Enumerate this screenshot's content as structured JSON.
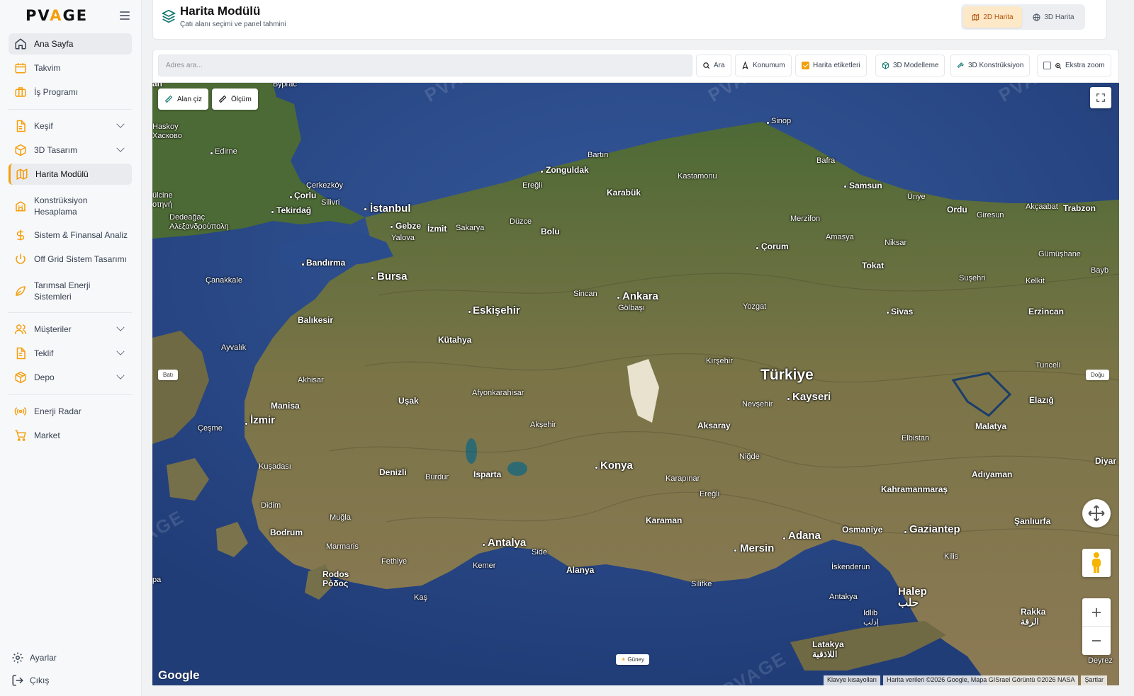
{
  "brand": {
    "logo_pre": "PV",
    "logo_mid": "A",
    "logo_post": "GE"
  },
  "sidebar": {
    "items": [
      {
        "label": "Ana Sayfa",
        "icon": "home-icon"
      },
      {
        "label": "Takvim",
        "icon": "calendar-icon"
      },
      {
        "label": "İş Programı",
        "icon": "briefcase-icon"
      },
      {
        "label": "Keşif",
        "icon": "file-icon"
      },
      {
        "label": "3D Tasarım",
        "icon": "cube-icon"
      },
      {
        "label": "Harita Modülü",
        "icon": "map-icon"
      },
      {
        "label": "Konstrüksiyon Hesaplama",
        "icon": "building-icon"
      },
      {
        "label": "Sistem & Finansal Analiz",
        "icon": "dollar-icon"
      },
      {
        "label": "Off Grid Sistem Tasarımı",
        "icon": "power-icon"
      },
      {
        "label": "Tarımsal Enerji Sistemleri",
        "icon": "leaf-icon"
      },
      {
        "label": "Müşteriler",
        "icon": "users-icon"
      },
      {
        "label": "Teklif",
        "icon": "document-icon"
      },
      {
        "label": "Depo",
        "icon": "package-icon"
      },
      {
        "label": "Enerji Radar",
        "icon": "radar-icon"
      },
      {
        "label": "Market",
        "icon": "cart-icon"
      }
    ],
    "footer": [
      {
        "label": "Ayarlar",
        "icon": "gear-icon"
      },
      {
        "label": "Çıkış",
        "icon": "logout-icon"
      }
    ]
  },
  "header": {
    "title": "Harita Modülü",
    "subtitle": "Çatı alanı seçimi ve panel tahmini",
    "view_2d": "2D Harita",
    "view_3d": "3D Harita",
    "active_view": "2D Harita"
  },
  "toolbar": {
    "search_placeholder": "Adres ara...",
    "search_button": "Ara",
    "location_button": "Konumum",
    "labels_toggle": "Harita etiketleri",
    "labels_checked": true,
    "modeling_button": "3D Modelleme",
    "construction_button": "3D Konstrüksiyon",
    "extra_zoom": "Ekstra zoom",
    "extra_zoom_checked": false
  },
  "map": {
    "draw_area": "Alan çiz",
    "measure": "Ölçüm",
    "compass": {
      "west": "Batı",
      "east": "Doğu",
      "south": "Güney"
    },
    "watermark": "PVAGE",
    "google": "Google",
    "attribution": {
      "shortcuts": "Klavye kısayolları",
      "data": "Harita verileri ©2026 Google, Mapa GISrael Görüntü ©2026 NASA",
      "terms": "Şartlar"
    },
    "country": "Türkiye",
    "places": [
      {
        "name": "Burgas",
        "text": "Бургас"
      },
      {
        "name": "Haskovo",
        "text": "Haskoy\nХасково"
      },
      {
        "name": "Edirne",
        "text": "Edirne"
      },
      {
        "name": "Çerkezköy",
        "text": "Çerkezköy"
      },
      {
        "name": "Çorlu",
        "text": "Çorlu"
      },
      {
        "name": "Silivri",
        "text": "Silivri"
      },
      {
        "name": "Tekirdağ",
        "text": "Tekirdağ"
      },
      {
        "name": "İstanbul",
        "text": "İstanbul"
      },
      {
        "name": "Gebze",
        "text": "Gebze"
      },
      {
        "name": "İzmit",
        "text": "İzmit"
      },
      {
        "name": "Sakarya",
        "text": "Sakarya"
      },
      {
        "name": "Yalova",
        "text": "Yalova"
      },
      {
        "name": "Dedeağaç",
        "text": "Dedeağaç\nΑλεξανδρούπολη"
      },
      {
        "name": "Komotini",
        "text": "ülcine\nοτηνή"
      },
      {
        "name": "Bartın",
        "text": "Bartın"
      },
      {
        "name": "Zonguldak",
        "text": "Zonguldak"
      },
      {
        "name": "Ereğli",
        "text": "Ereğli"
      },
      {
        "name": "Karabük",
        "text": "Karabük"
      },
      {
        "name": "Kastamonu",
        "text": "Kastamonu"
      },
      {
        "name": "Sinop",
        "text": "Sinop"
      },
      {
        "name": "Bafra",
        "text": "Bafra"
      },
      {
        "name": "Samsun",
        "text": "Samsun"
      },
      {
        "name": "Ünye",
        "text": "Ünye"
      },
      {
        "name": "Ordu",
        "text": "Ordu"
      },
      {
        "name": "Giresun",
        "text": "Giresun"
      },
      {
        "name": "Akçaabat",
        "text": "Akçaabat"
      },
      {
        "name": "Trabzon",
        "text": "Trabzon"
      },
      {
        "name": "Düzce",
        "text": "Düzce"
      },
      {
        "name": "Bolu",
        "text": "Bolu"
      },
      {
        "name": "Merzifon",
        "text": "Merzifon"
      },
      {
        "name": "Amasya",
        "text": "Amasya"
      },
      {
        "name": "Niksar",
        "text": "Niksar"
      },
      {
        "name": "Çorum",
        "text": "Çorum"
      },
      {
        "name": "Tokat",
        "text": "Tokat"
      },
      {
        "name": "Gümüşhane",
        "text": "Gümüşhane"
      },
      {
        "name": "Bayburt",
        "text": "Bayb"
      },
      {
        "name": "Suşehri",
        "text": "Suşehri"
      },
      {
        "name": "Kelkit",
        "text": "Kelkit"
      },
      {
        "name": "Bandırma",
        "text": "Bandırma"
      },
      {
        "name": "Bursa",
        "text": "Bursa"
      },
      {
        "name": "Çanakkale",
        "text": "Çanakkale"
      },
      {
        "name": "Sincan",
        "text": "Sincan"
      },
      {
        "name": "Ankara",
        "text": "Ankara"
      },
      {
        "name": "Gölbaşı",
        "text": "Gölbaşı"
      },
      {
        "name": "Yozgat",
        "text": "Yozgat"
      },
      {
        "name": "Sivas",
        "text": "Sivas"
      },
      {
        "name": "Erzincan",
        "text": "Erzincan"
      },
      {
        "name": "Eskişehir",
        "text": "Eskişehir"
      },
      {
        "name": "Balıkesir",
        "text": "Balıkesir"
      },
      {
        "name": "Kütahya",
        "text": "Kütahya"
      },
      {
        "name": "Ayvalık",
        "text": "Ayvalık"
      },
      {
        "name": "Kırşehir",
        "text": "Kırşehir"
      },
      {
        "name": "Tunceli",
        "text": "Tunceli"
      },
      {
        "name": "Akhisar",
        "text": "Akhisar"
      },
      {
        "name": "Afyonkarahisar",
        "text": "Afyonkarahisar"
      },
      {
        "name": "Kayseri",
        "text": "Kayseri"
      },
      {
        "name": "Nevşehir",
        "text": "Nevşehir"
      },
      {
        "name": "Elazığ",
        "text": "Elazığ"
      },
      {
        "name": "Manisa",
        "text": "Manisa"
      },
      {
        "name": "Uşak",
        "text": "Uşak"
      },
      {
        "name": "İzmir",
        "text": "İzmir"
      },
      {
        "name": "Çeşme",
        "text": "Çeşme"
      },
      {
        "name": "Akşehir",
        "text": "Akşehir"
      },
      {
        "name": "Aksaray",
        "text": "Aksaray"
      },
      {
        "name": "Malatya",
        "text": "Malatya"
      },
      {
        "name": "Elbistan",
        "text": "Elbistan"
      },
      {
        "name": "Niğde",
        "text": "Niğde"
      },
      {
        "name": "Diyarbakır",
        "text": "Diyar"
      },
      {
        "name": "Kuşadası",
        "text": "Kuşadası"
      },
      {
        "name": "Denizli",
        "text": "Denizli"
      },
      {
        "name": "Burdur",
        "text": "Burdur"
      },
      {
        "name": "Isparta",
        "text": "Isparta"
      },
      {
        "name": "Konya",
        "text": "Konya"
      },
      {
        "name": "Karapınar",
        "text": "Karapınar"
      },
      {
        "name": "Adıyaman",
        "text": "Adıyaman"
      },
      {
        "name": "Kahramanmaraş",
        "text": "Kahramanmaraş"
      },
      {
        "name": "Ereğli2",
        "text": "Ereğli"
      },
      {
        "name": "Didim",
        "text": "Didim"
      },
      {
        "name": "Muğla",
        "text": "Muğla"
      },
      {
        "name": "Karaman",
        "text": "Karaman"
      },
      {
        "name": "Şanlıurfa",
        "text": "Şanlıurfa"
      },
      {
        "name": "Bodrum",
        "text": "Bodrum"
      },
      {
        "name": "Osmaniye",
        "text": "Osmaniye"
      },
      {
        "name": "Gaziantep",
        "text": "Gaziantep"
      },
      {
        "name": "Adana",
        "text": "Adana"
      },
      {
        "name": "Antalya",
        "text": "Antalya"
      },
      {
        "name": "Marmaris",
        "text": "Marmaris"
      },
      {
        "name": "Side",
        "text": "Side"
      },
      {
        "name": "Mersin",
        "text": "Mersin"
      },
      {
        "name": "Kilis",
        "text": "Kilis"
      },
      {
        "name": "Fethiye",
        "text": "Fethiye"
      },
      {
        "name": "Kemer",
        "text": "Kemer"
      },
      {
        "name": "Alanya",
        "text": "Alanya"
      },
      {
        "name": "İskenderun",
        "text": "İskenderun"
      },
      {
        "name": "Rodos",
        "text": "Rodos\nΡόδος"
      },
      {
        "name": "Silifke",
        "text": "Silifke"
      },
      {
        "name": "Kaş",
        "text": "Kaş"
      },
      {
        "name": "Antakya",
        "text": "Antakya"
      },
      {
        "name": "Halep",
        "text": "Halep\nحلب"
      },
      {
        "name": "Idlib",
        "text": "Idlib\nإدلب"
      },
      {
        "name": "Rakka",
        "text": "Rakka\nالرقة"
      },
      {
        "name": "Latakya",
        "text": "Latakya\nاللاذقية"
      },
      {
        "name": "Deir",
        "text": "Deyrez"
      },
      {
        "name": "Pa",
        "text": "pa"
      },
      {
        "name": "Tan",
        "text": "an"
      }
    ]
  },
  "colors": {
    "accent": "#f59e0b",
    "active_bg": "#e9ebef",
    "sea": "#2c4c8c",
    "land": "#5b6f43"
  }
}
